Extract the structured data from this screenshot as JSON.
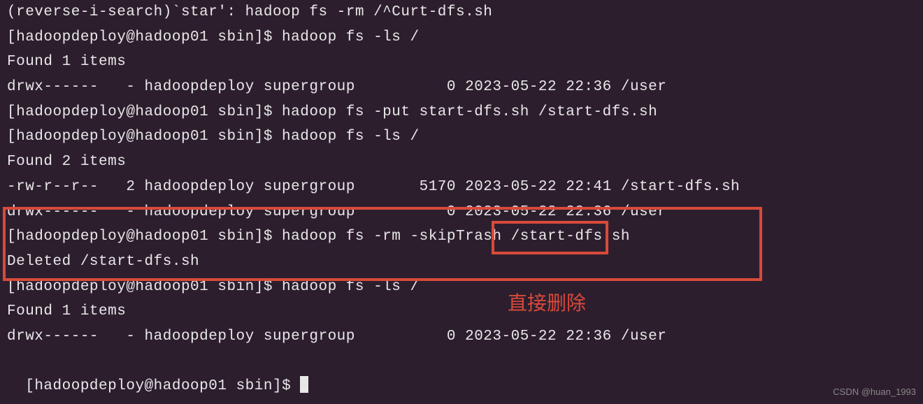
{
  "lines": {
    "l0": "(reverse-i-search)`star': hadoop fs -rm /^Curt-dfs.sh",
    "l1": "[hadoopdeploy@hadoop01 sbin]$ hadoop fs -ls /",
    "l2": "Found 1 items",
    "l3": "drwx------   - hadoopdeploy supergroup          0 2023-05-22 22:36 /user",
    "l4": "[hadoopdeploy@hadoop01 sbin]$ hadoop fs -put start-dfs.sh /start-dfs.sh",
    "l5": "[hadoopdeploy@hadoop01 sbin]$ hadoop fs -ls /",
    "l6": "Found 2 items",
    "l7": "-rw-r--r--   2 hadoopdeploy supergroup       5170 2023-05-22 22:41 /start-dfs.sh",
    "l8": "drwx------   - hadoopdeploy supergroup          0 2023-05-22 22:36 /user",
    "l9": "[hadoopdeploy@hadoop01 sbin]$ hadoop fs -rm -skipTrash /start-dfs.sh",
    "l10": "Deleted /start-dfs.sh",
    "l11": "[hadoopdeploy@hadoop01 sbin]$ hadoop fs -ls /",
    "l12": "Found 1 items",
    "l13": "drwx------   - hadoopdeploy supergroup          0 2023-05-22 22:36 /user",
    "l14": "[hadoopdeploy@hadoop01 sbin]$ "
  },
  "annotation": "直接删除",
  "watermark": "CSDN @huan_1993",
  "highlight": {
    "outer_color": "#d84a3a",
    "inner_color": "#d84a3a",
    "highlighted_option": "-skipTrash"
  }
}
